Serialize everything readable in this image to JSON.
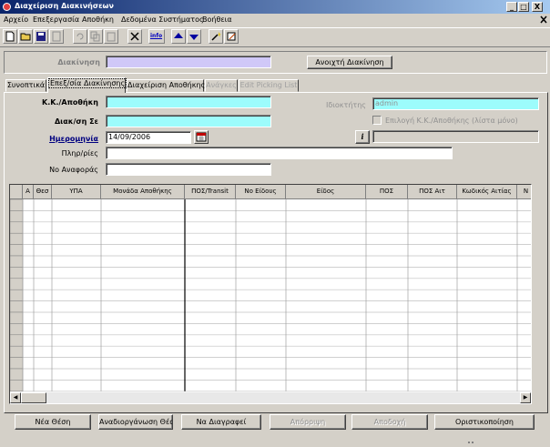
{
  "window": {
    "title": "Διαχείριση Διακινήσεων",
    "controls": [
      "_",
      "□",
      "X"
    ]
  },
  "menu": [
    "Αρχείο",
    "Επεξεργασία",
    "Αποθήκη",
    "Δεδομένα Συστήματος",
    "Βοήθεια"
  ],
  "toolbar": {
    "info_label": "info"
  },
  "header": {
    "movement_label": "Διακίνηση",
    "movement_value": "",
    "status_button": "Ανοιχτή Διακίνηση"
  },
  "tabs": [
    {
      "label": "Συνοπτικά",
      "state": "normal"
    },
    {
      "label": "Επεξ/σία Διακίνησης",
      "state": "active"
    },
    {
      "label": "Διαχείριση Αποθήκης",
      "state": "normal"
    },
    {
      "label": "Ανάγκες",
      "state": "disabled"
    },
    {
      "label": "Edit Picking List",
      "state": "disabled"
    }
  ],
  "form": {
    "warehouse_label": "Κ.Κ./Αποθήκη",
    "warehouse_value": "",
    "transfer_to_label": "Διακ/ση Σε",
    "transfer_to_value": "",
    "date_label": "Ημερομηνία",
    "date_value": "14/09/2006",
    "info_text_label": "Πληρ/ρίες",
    "info_text_value": "",
    "reference_label": "Νο Αναφοράς",
    "reference_value": "",
    "owner_label": "Ιδιοκτήτης",
    "owner_value": "admin",
    "checkbox_label": "Επιλογή Κ.Κ./Αποθήκης (λίστα μόνο)",
    "info_button": "i",
    "side_field_value": ""
  },
  "grid": {
    "columns": [
      "Α",
      "Θεσ",
      "ΥΠΑ",
      "Μονάδα Αποθήκης",
      "ΠΟΣ/Transit",
      "Νο Είδους",
      "Είδος",
      "ΠΟΣ",
      "ΠΟΣ Αιτ",
      "Κωδικός Αιτίας",
      "Ν"
    ],
    "row_count": 17
  },
  "buttons": [
    {
      "label": "Νέα Θέση",
      "enabled": true
    },
    {
      "label": "Αναδιοργάνωση Θέσεων",
      "enabled": true
    },
    {
      "label": "Να Διαγραφεί",
      "enabled": true
    },
    {
      "label": "Απόρριψη",
      "enabled": false
    },
    {
      "label": "Αποδοχή",
      "enabled": false
    },
    {
      "label": "Οριστικοποίηση",
      "enabled": true
    }
  ],
  "colors": {
    "title_start": "#0a246a",
    "title_end": "#a6caf0",
    "field_cyan": "#9cfcfc",
    "field_lavender": "#d0c8f8",
    "face": "#d4d0c8"
  }
}
